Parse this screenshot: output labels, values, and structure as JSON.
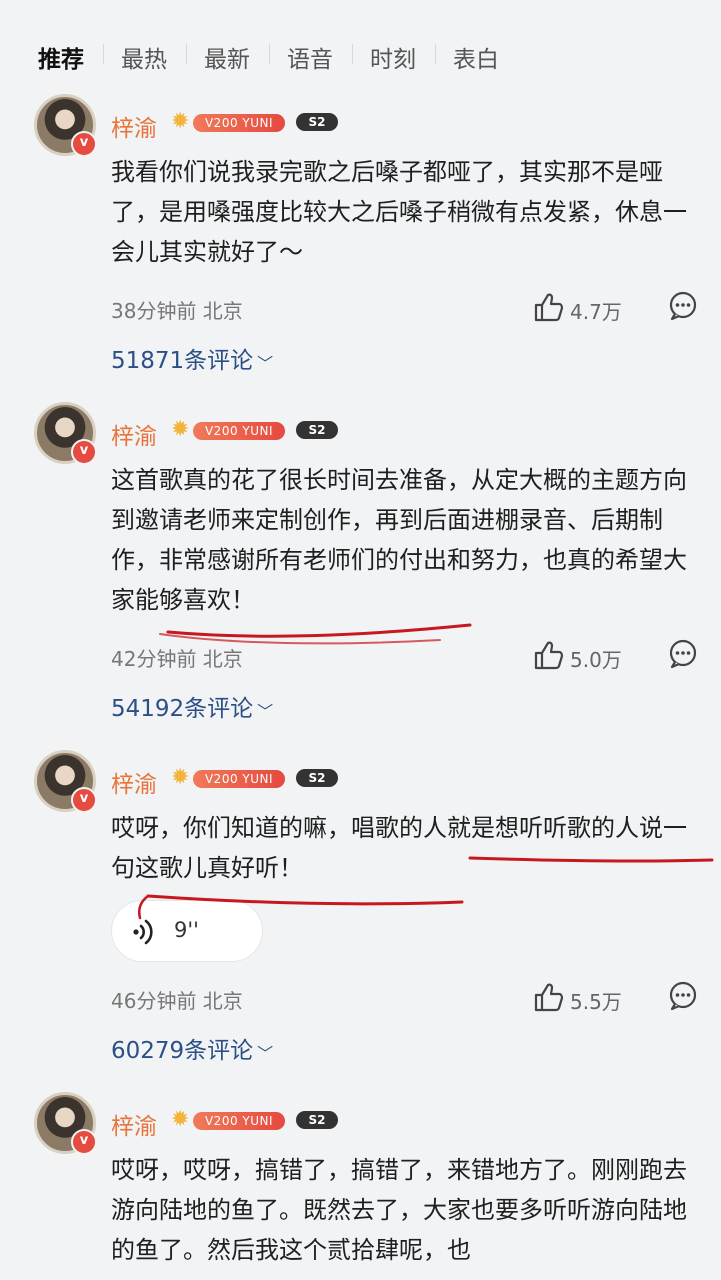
{
  "tabs": [
    "推荐",
    "最热",
    "最新",
    "语音",
    "时刻",
    "表白"
  ],
  "posts": [
    {
      "username": "梓渝",
      "vip_label": "V200 YUNI",
      "level_badge": "S2",
      "content": "我看你们说我录完歌之后嗓子都哑了，其实那不是哑了，是用嗓强度比较大之后嗓子稍微有点发紧，休息一会儿其实就好了～",
      "meta": "38分钟前 北京",
      "likes": "4.7万",
      "comments": "51871条评论"
    },
    {
      "username": "梓渝",
      "vip_label": "V200 YUNI",
      "level_badge": "S2",
      "content": "这首歌真的花了很长时间去准备，从定大概的主题方向到邀请老师来定制创作，再到后面进棚录音、后期制作，非常感谢所有老师们的付出和努力，也真的希望大家能够喜欢！",
      "meta": "42分钟前 北京",
      "likes": "5.0万",
      "comments": "54192条评论"
    },
    {
      "username": "梓渝",
      "vip_label": "V200 YUNI",
      "level_badge": "S2",
      "content": "哎呀，你们知道的嘛，唱歌的人就是想听听歌的人说一句这歌儿真好听！",
      "voice_duration": "9''",
      "meta": "46分钟前 北京",
      "likes": "5.5万",
      "comments": "60279条评论"
    },
    {
      "username": "梓渝",
      "vip_label": "V200 YUNI",
      "level_badge": "S2",
      "content": "哎呀，哎呀，搞错了，搞错了，来错地方了。刚刚跑去游向陆地的鱼了。既然去了，大家也要多听听游向陆地的鱼了。然后我这个贰拾肆呢，也"
    }
  ],
  "colors": {
    "background": "#f1f3f5",
    "username": "#e8743b",
    "comment_link": "#2c4f86",
    "ink_underline": "#c8181f"
  }
}
